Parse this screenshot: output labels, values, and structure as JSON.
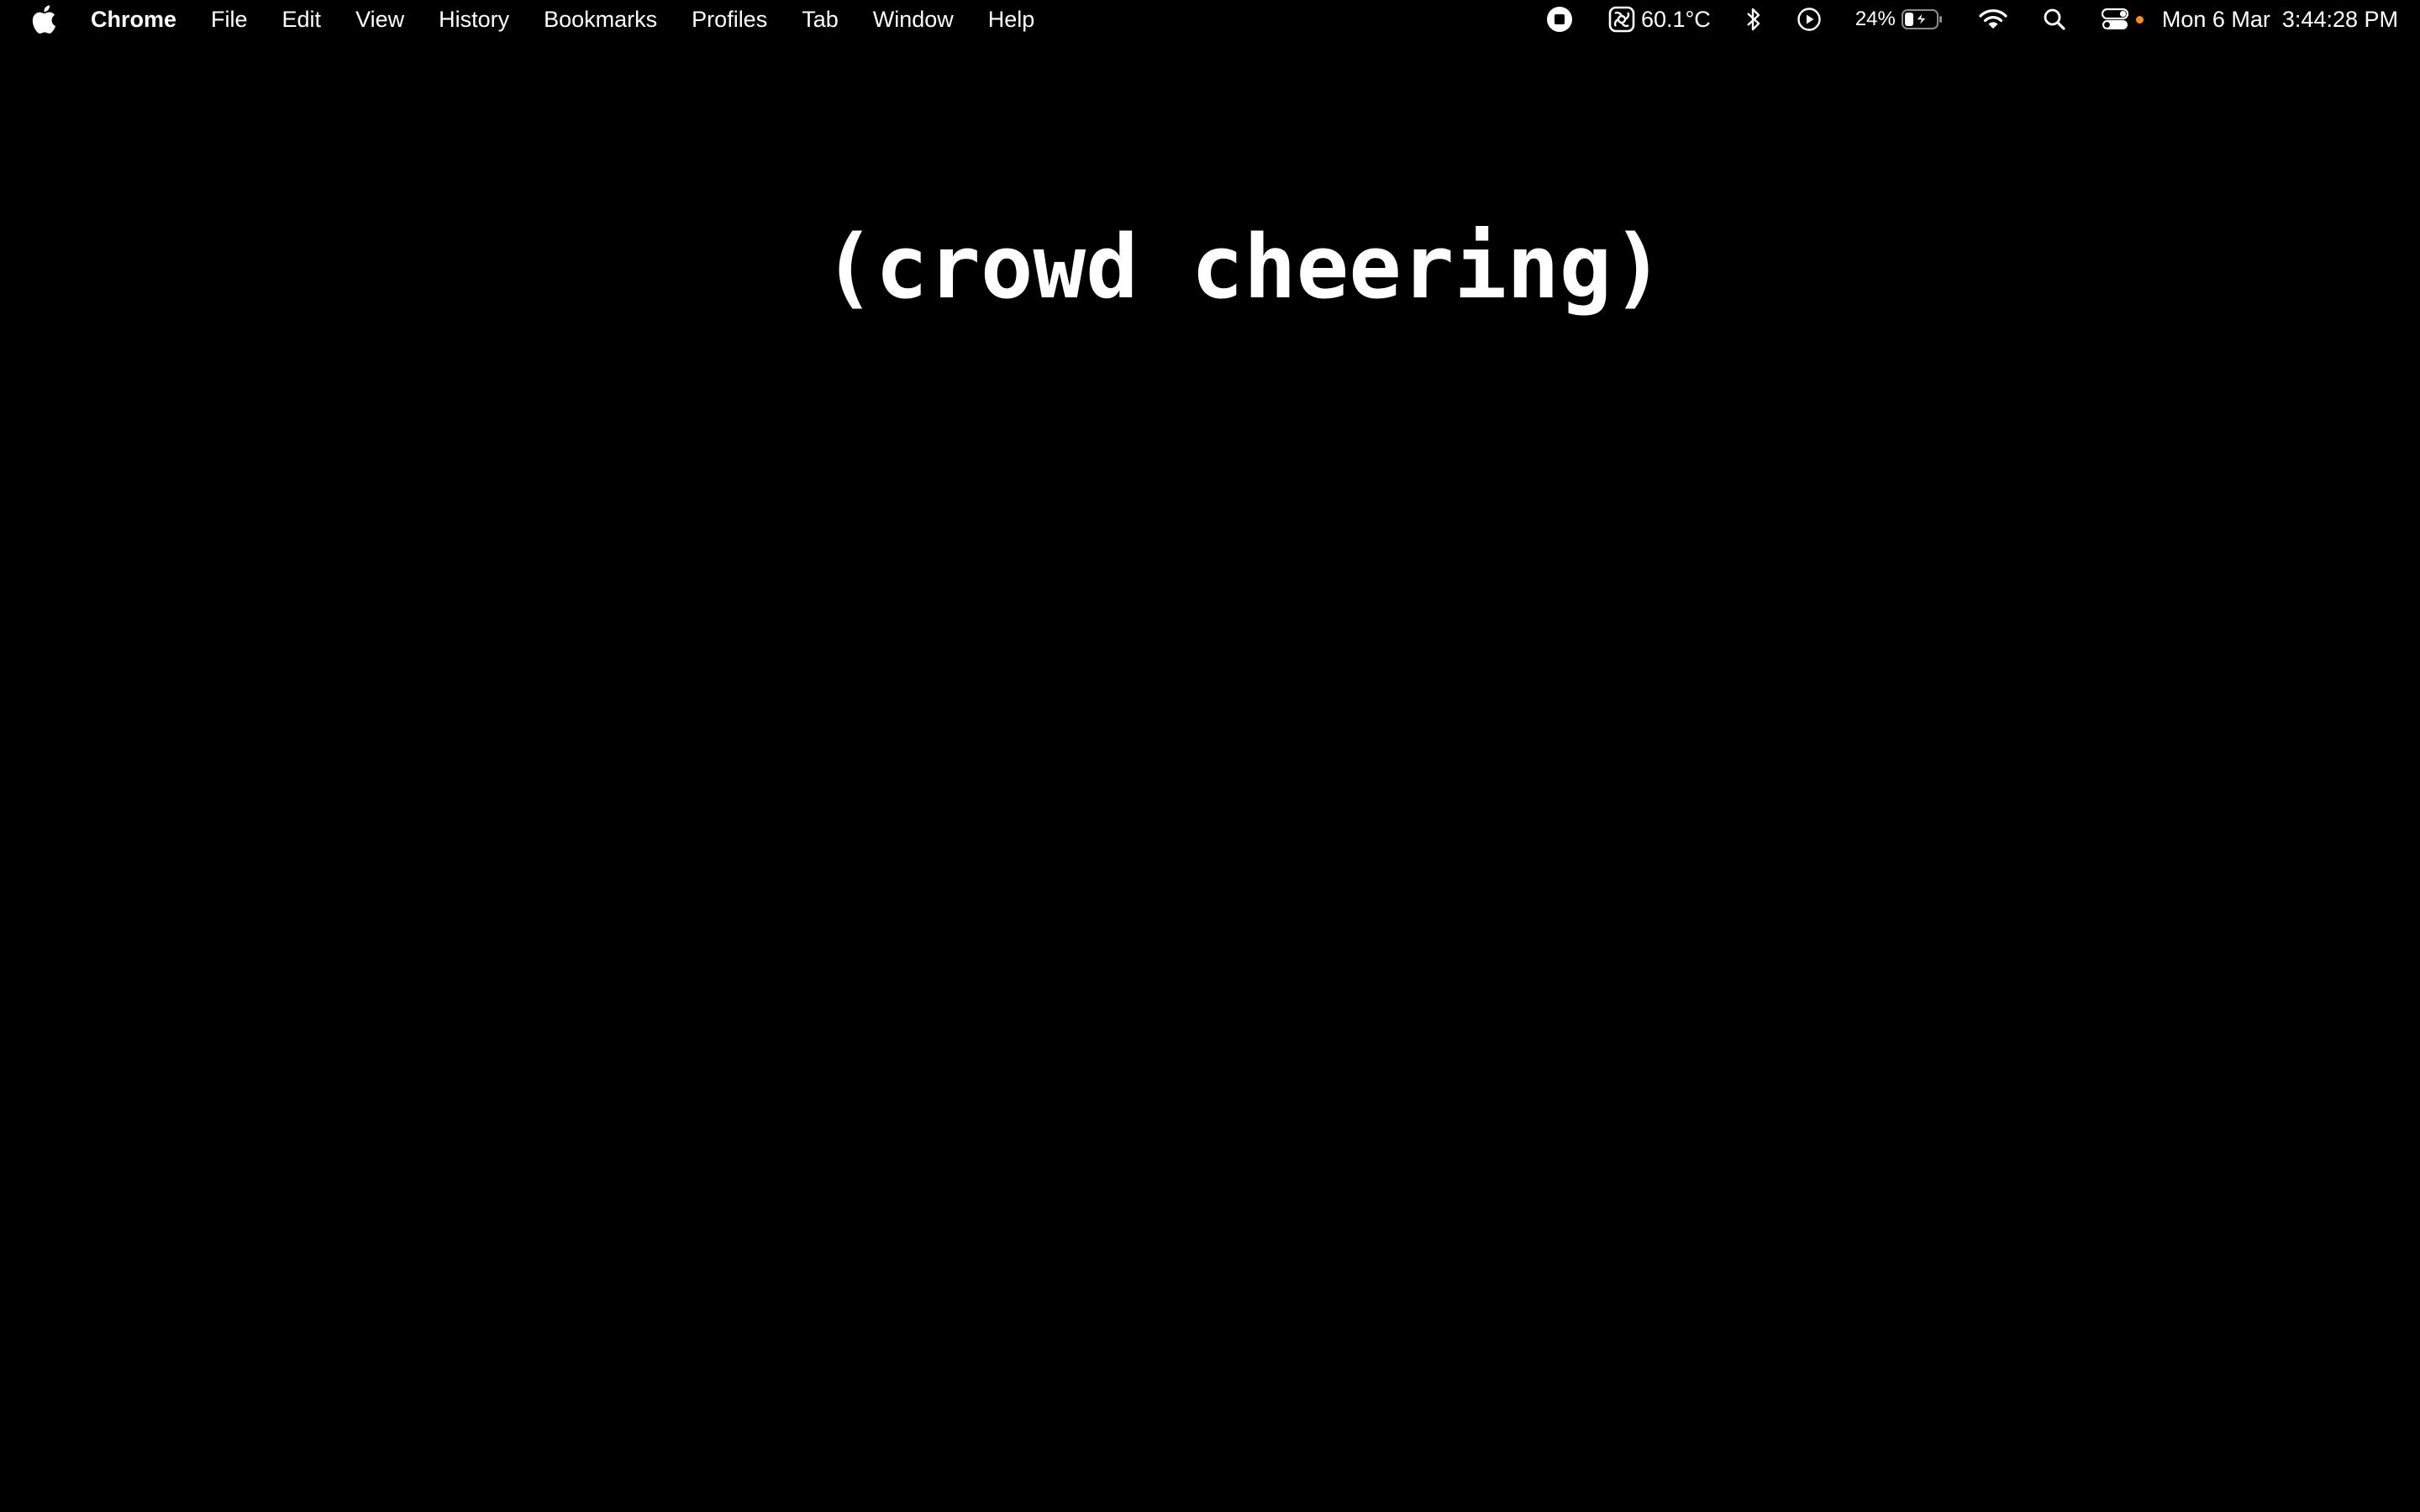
{
  "menubar": {
    "apple_icon": "apple-logo-icon",
    "items": [
      {
        "label": "Chrome",
        "bold": true
      },
      {
        "label": "File"
      },
      {
        "label": "Edit"
      },
      {
        "label": "View"
      },
      {
        "label": "History"
      },
      {
        "label": "Bookmarks"
      },
      {
        "label": "Profiles"
      },
      {
        "label": "Tab"
      },
      {
        "label": "Window"
      },
      {
        "label": "Help"
      }
    ],
    "status": {
      "record_icon": "stop-recording-icon",
      "temp_icon": "cpu-chip-icon",
      "temperature": "60.1°C",
      "bluetooth_icon": "bluetooth-icon",
      "play_icon": "play-circle-icon",
      "battery_percent": "24%",
      "battery_icon": "battery-charging-icon",
      "wifi_icon": "wifi-icon",
      "search_icon": "spotlight-search-icon",
      "control_center_icon": "control-center-icon",
      "indicator_color": "#ff8c1a",
      "date": "Mon 6 Mar",
      "time": "3:44:28 PM"
    }
  },
  "main": {
    "caption": "(crowd cheering)"
  },
  "colors": {
    "background": "#000000",
    "text": "#ffffff"
  }
}
